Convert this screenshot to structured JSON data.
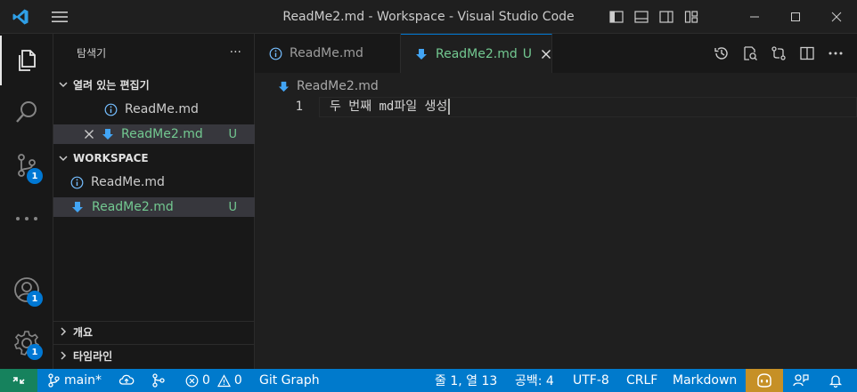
{
  "window": {
    "title": "ReadMe2.md - Workspace - Visual Studio Code",
    "icons": [
      "vscode-logo-icon",
      "hamburger-menu-icon",
      "toggle-primary-sidebar-icon",
      "toggle-panel-icon",
      "toggle-secondary-sidebar-icon",
      "customize-layout-icon",
      "minimize-icon",
      "maximize-icon",
      "close-icon"
    ]
  },
  "activity_bar": {
    "items": [
      {
        "name": "explorer",
        "icon": "files-icon"
      },
      {
        "name": "search",
        "icon": "search-icon"
      },
      {
        "name": "source-control",
        "icon": "source-control-icon",
        "badge": "1"
      },
      {
        "name": "more",
        "icon": "ellipsis-icon"
      },
      {
        "name": "accounts",
        "icon": "account-icon",
        "badge": "1"
      },
      {
        "name": "manage",
        "icon": "gear-icon",
        "badge": "1"
      }
    ]
  },
  "sidebar": {
    "title": "탐색기",
    "more": "···",
    "open_editors": {
      "header": "열려 있는 편집기",
      "items": [
        {
          "label": "ReadMe.md",
          "icon": "info-icon",
          "status": ""
        },
        {
          "label": "ReadMe2.md",
          "icon": "markdown-download-icon",
          "status": "U"
        }
      ]
    },
    "workspace": {
      "header": "WORKSPACE",
      "items": [
        {
          "label": "ReadMe.md",
          "icon": "info-icon",
          "status": ""
        },
        {
          "label": "ReadMe2.md",
          "icon": "markdown-download-icon",
          "status": "U"
        }
      ]
    },
    "outline": "개요",
    "timeline": "타임라인"
  },
  "tabs": [
    {
      "label": "ReadMe.md",
      "icon": "info-icon",
      "active": false,
      "status": ""
    },
    {
      "label": "ReadMe2.md",
      "icon": "markdown-download-icon",
      "active": true,
      "status": "U"
    }
  ],
  "editor_actions": [
    "timeline-history-icon",
    "open-preview-icon",
    "git-compare-icon",
    "split-editor-icon",
    "more-actions-icon"
  ],
  "editor": {
    "breadcrumb": "ReadMe2.md",
    "lines": [
      {
        "number": "1",
        "text": "두 번째 md파일 생성"
      }
    ]
  },
  "status_bar": {
    "branch": "main*",
    "errors": "0",
    "warnings": "0",
    "git_graph": "Git Graph",
    "position": "줄 1, 열 13",
    "spaces": "공백: 4",
    "encoding": "UTF-8",
    "eol": "CRLF",
    "language": "Markdown",
    "colors": {
      "bar": "#007acc",
      "remote": "#16825d",
      "copilot": "#c69026"
    }
  }
}
